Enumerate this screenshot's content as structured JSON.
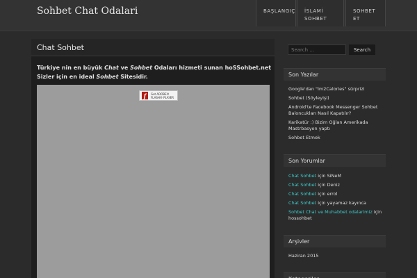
{
  "site": {
    "title": "Sohbet Chat Odalari"
  },
  "nav": {
    "items": [
      {
        "label": "BAŞLANGIÇ"
      },
      {
        "label": "İSLAMİ SOHBET"
      },
      {
        "label": "SOHBET ET"
      }
    ]
  },
  "post": {
    "title": "Chat Sohbet",
    "intro": {
      "p1": "Türkiye nin en büyük ",
      "em1": "Chat",
      "p2": " ve ",
      "em2": "Sohbet",
      "p3": " Odaları hizmeti sunan hoSSohbet.net Sizler için en ideal ",
      "em3": "Sohbet",
      "p4": " Sitesidir."
    },
    "flash_badge": {
      "line1": "Get ADOBE®",
      "line2": "FLASH® PLAYER"
    }
  },
  "sidebar": {
    "search": {
      "placeholder": "Search …",
      "button": "Search"
    },
    "recent_posts": {
      "title": "Son Yazılar",
      "items": [
        {
          "label": "Google'dan \"Im2Calories\" sürprizi"
        },
        {
          "label": "Sohbet (Söyleyişi)"
        },
        {
          "label": "Android'te Facebook Messenger Sohbet Baloncukları Nasıl Kapatılır?"
        },
        {
          "label": "Karikatür :) Bizim Oğlan Amerikada Mastrbasyon yaptı"
        },
        {
          "label": "Sohbet Etmek"
        }
      ]
    },
    "recent_comments": {
      "title": "Son Yorumlar",
      "items": [
        {
          "link": "Chat Sohbet",
          "text": " için SiNeM"
        },
        {
          "link": "Chat Sohbet",
          "text": " için Deniz"
        },
        {
          "link": "Chat Sohbet",
          "text": " için errol"
        },
        {
          "link": "Chat Sohbet",
          "text": " için yayamaz kayınca"
        },
        {
          "link": "Sohbet Chat ve Muhabbet odalarimiz",
          "text": " için hossohbet"
        }
      ]
    },
    "archives": {
      "title": "Arşivler",
      "items": [
        {
          "label": "Haziran 2015"
        }
      ]
    },
    "categories": {
      "title": "Kategoriler"
    }
  },
  "colors": {
    "link": "#3ec6c6",
    "background": "#2b2b2b",
    "header": "#333333"
  }
}
